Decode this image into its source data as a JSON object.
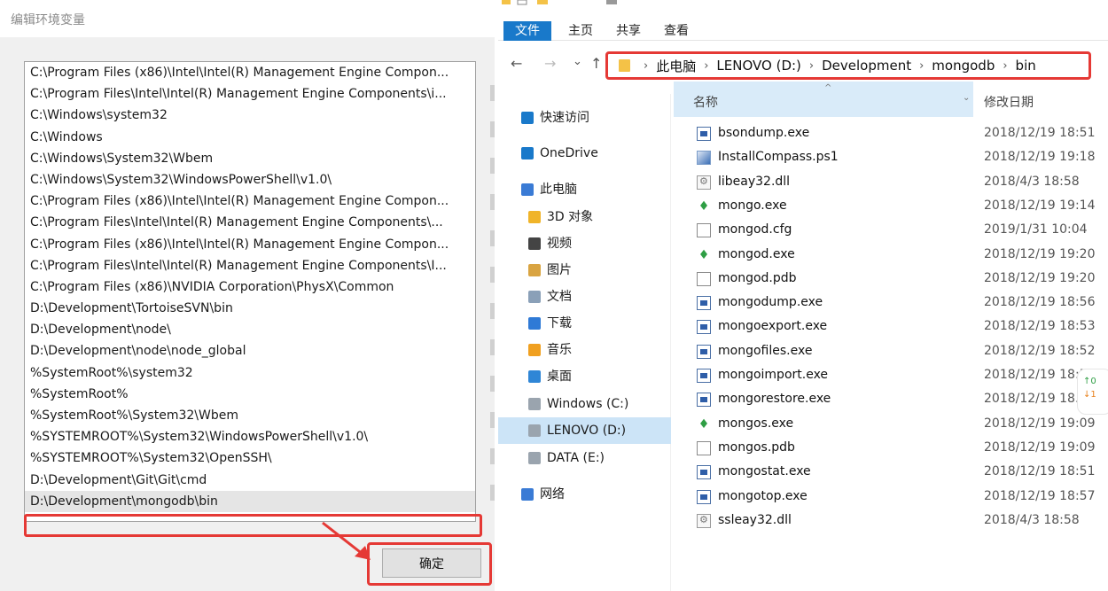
{
  "env_dialog": {
    "title": "编辑环境变量",
    "paths": [
      "C:\\Program Files (x86)\\Intel\\Intel(R) Management Engine Compon...",
      "C:\\Program Files\\Intel\\Intel(R) Management Engine Components\\i...",
      "C:\\Windows\\system32",
      "C:\\Windows",
      "C:\\Windows\\System32\\Wbem",
      "C:\\Windows\\System32\\WindowsPowerShell\\v1.0\\",
      "C:\\Program Files (x86)\\Intel\\Intel(R) Management Engine Compon...",
      "C:\\Program Files\\Intel\\Intel(R) Management Engine Components\\...",
      "C:\\Program Files (x86)\\Intel\\Intel(R) Management Engine Compon...",
      "C:\\Program Files\\Intel\\Intel(R) Management Engine Components\\I...",
      "C:\\Program Files (x86)\\NVIDIA Corporation\\PhysX\\Common",
      "D:\\Development\\TortoiseSVN\\bin",
      "D:\\Development\\node\\",
      "D:\\Development\\node\\node_global",
      "%SystemRoot%\\system32",
      "%SystemRoot%",
      "%SystemRoot%\\System32\\Wbem",
      "%SYSTEMROOT%\\System32\\WindowsPowerShell\\v1.0\\",
      "%SYSTEMROOT%\\System32\\OpenSSH\\",
      "D:\\Development\\Git\\Git\\cmd",
      "D:\\Development\\mongodb\\bin"
    ],
    "selected_index": 20,
    "ok_label": "确定"
  },
  "explorer": {
    "ribbon_tabs": [
      "文件",
      "主页",
      "共享",
      "查看"
    ],
    "nav_back": "←",
    "nav_forward": "→",
    "nav_recent": "⌄",
    "nav_up": "↑",
    "breadcrumb": [
      "此电脑",
      "LENOVO (D:)",
      "Development",
      "mongodb",
      "bin"
    ],
    "nav_pane": [
      {
        "label": "快速访问",
        "icon": "star-icon",
        "color": "#1979ca"
      },
      {
        "label": "OneDrive",
        "icon": "cloud-icon",
        "color": "#1979ca"
      },
      {
        "label": "此电脑",
        "icon": "computer-icon",
        "color": "#3a7bd5"
      },
      {
        "label": "3D 对象",
        "icon": "3d-objects-icon",
        "color": "#f0b429"
      },
      {
        "label": "视频",
        "icon": "video-icon",
        "color": "#444444"
      },
      {
        "label": "图片",
        "icon": "pictures-icon",
        "color": "#d9a441"
      },
      {
        "label": "文档",
        "icon": "documents-icon",
        "color": "#8aa0b8"
      },
      {
        "label": "下载",
        "icon": "downloads-icon",
        "color": "#2f7ad6"
      },
      {
        "label": "音乐",
        "icon": "music-icon",
        "color": "#f0a020"
      },
      {
        "label": "桌面",
        "icon": "desktop-icon",
        "color": "#2f86d6"
      },
      {
        "label": "Windows (C:)",
        "icon": "drive-c-icon",
        "color": "#9aa4ae"
      },
      {
        "label": "LENOVO (D:)",
        "icon": "drive-d-icon",
        "color": "#9aa4ae"
      },
      {
        "label": "DATA (E:)",
        "icon": "drive-e-icon",
        "color": "#9aa4ae"
      },
      {
        "label": "网络",
        "icon": "network-icon",
        "color": "#3a7bd5"
      }
    ],
    "selected_nav_index": 11,
    "columns": {
      "name": "名称",
      "date": "修改日期",
      "sort_indicator": "^",
      "chevron": "⌄"
    },
    "files": [
      {
        "name": "bsondump.exe",
        "date": "2018/12/19 18:51",
        "type": "exe"
      },
      {
        "name": "InstallCompass.ps1",
        "date": "2018/12/19 19:18",
        "type": "ps"
      },
      {
        "name": "libeay32.dll",
        "date": "2018/4/3 18:58",
        "type": "dll"
      },
      {
        "name": "mongo.exe",
        "date": "2018/12/19 19:14",
        "type": "leaf"
      },
      {
        "name": "mongod.cfg",
        "date": "2019/1/31 10:04",
        "type": "doc"
      },
      {
        "name": "mongod.exe",
        "date": "2018/12/19 19:20",
        "type": "leaf"
      },
      {
        "name": "mongod.pdb",
        "date": "2018/12/19 19:20",
        "type": "doc"
      },
      {
        "name": "mongodump.exe",
        "date": "2018/12/19 18:56",
        "type": "exe"
      },
      {
        "name": "mongoexport.exe",
        "date": "2018/12/19 18:53",
        "type": "exe"
      },
      {
        "name": "mongofiles.exe",
        "date": "2018/12/19 18:52",
        "type": "exe"
      },
      {
        "name": "mongoimport.exe",
        "date": "2018/12/19 18:5",
        "type": "exe"
      },
      {
        "name": "mongorestore.exe",
        "date": "2018/12/19 18.",
        "type": "exe"
      },
      {
        "name": "mongos.exe",
        "date": "2018/12/19 19:09",
        "type": "leaf"
      },
      {
        "name": "mongos.pdb",
        "date": "2018/12/19 19:09",
        "type": "doc"
      },
      {
        "name": "mongostat.exe",
        "date": "2018/12/19 18:51",
        "type": "exe"
      },
      {
        "name": "mongotop.exe",
        "date": "2018/12/19 18:57",
        "type": "exe"
      },
      {
        "name": "ssleay32.dll",
        "date": "2018/4/3 18:58",
        "type": "dll"
      }
    ]
  },
  "counter": {
    "up": "↑0",
    "down": "↓1"
  },
  "colors": {
    "accent": "#1979ca",
    "highlight": "#e53935",
    "selected_nav": "#cce4f7"
  }
}
